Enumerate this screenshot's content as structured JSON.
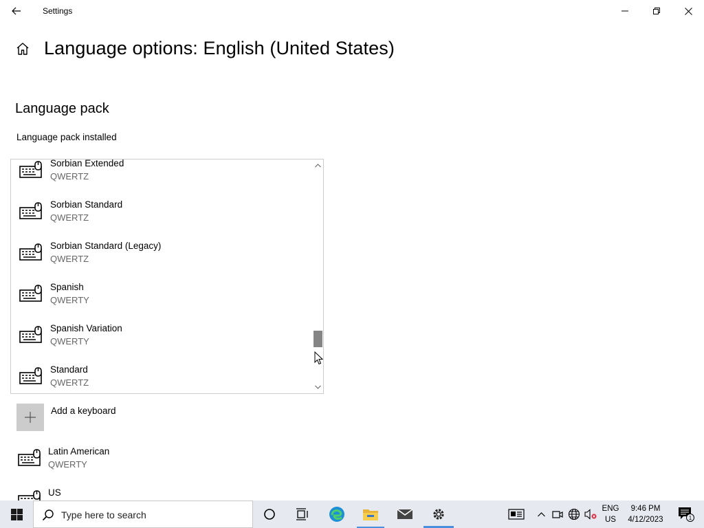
{
  "window": {
    "title": "Settings"
  },
  "page": {
    "title": "Language options: English (United States)"
  },
  "language_pack": {
    "heading": "Language pack",
    "status": "Language pack installed"
  },
  "keyboard_list": {
    "items": [
      {
        "name": "Sorbian Extended",
        "layout": "QWERTZ"
      },
      {
        "name": "Sorbian Standard",
        "layout": "QWERTZ"
      },
      {
        "name": "Sorbian Standard (Legacy)",
        "layout": "QWERTZ"
      },
      {
        "name": "Spanish",
        "layout": "QWERTY"
      },
      {
        "name": "Spanish Variation",
        "layout": "QWERTY"
      },
      {
        "name": "Standard",
        "layout": "QWERTZ"
      }
    ],
    "scroll_position": 0.82
  },
  "add_keyboard": {
    "label": "Add a keyboard"
  },
  "installed_keyboards": [
    {
      "name": "Latin American",
      "layout": "QWERTY"
    },
    {
      "name": "US",
      "layout": ""
    }
  ],
  "taskbar": {
    "search_placeholder": "Type here to search",
    "apps": [
      "cortana-icon",
      "task-view-icon",
      "edge-icon",
      "file-explorer-icon",
      "mail-icon",
      "settings-icon"
    ],
    "language": {
      "line1": "ENG",
      "line2": "US"
    },
    "clock": {
      "time": "9:46 PM",
      "date": "4/12/2023"
    },
    "notification_count": "1"
  },
  "colors": {
    "accent": "#4a8ee0",
    "taskbar_bg": "#e6e9ef",
    "secondary_text": "#666666",
    "scroll_thumb": "#858585"
  }
}
